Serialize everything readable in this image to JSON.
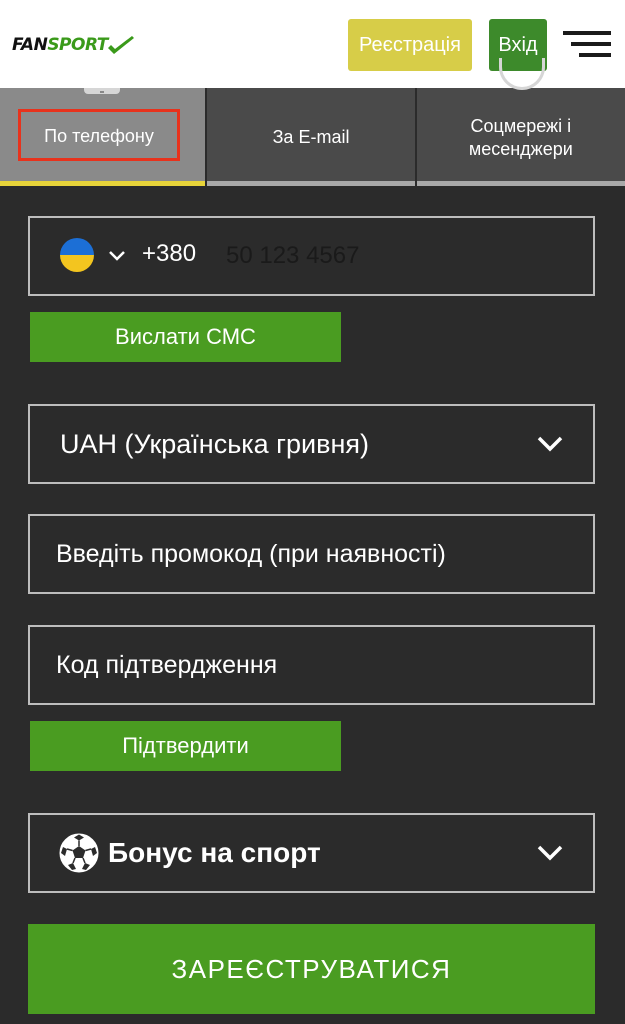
{
  "header": {
    "logo": {
      "part1": "FAN",
      "part2": "SPORT"
    },
    "register_label": "Реєстрація",
    "login_label": "Вхід",
    "menu_icon": "hamburger-menu-icon"
  },
  "tabs": [
    {
      "label": "По телефону",
      "active": true
    },
    {
      "label": "За E-mail",
      "active": false
    },
    {
      "label_line1": "Соцмережі і",
      "label_line2": "месенджери",
      "active": false
    }
  ],
  "form": {
    "phone": {
      "flag": "ukraine-flag-icon",
      "country_code": "+380",
      "placeholder": "50 123 4567"
    },
    "send_sms_label": "Вислати СМС",
    "currency": {
      "value": "UAH (Українська гривня)"
    },
    "promo": {
      "placeholder": "Введіть промокод (при наявності)"
    },
    "confirmation_code": {
      "placeholder": "Код підтвердження"
    },
    "confirm_label": "Підтвердити",
    "bonus": {
      "value": "Бонус на спорт",
      "icon": "soccer-ball-icon"
    },
    "register_label": "ЗАРЕЄСТРУВАТИСЯ"
  },
  "colors": {
    "background": "#2b2b2b",
    "accent_green": "#4a9c21",
    "register_yellow": "#d7cd48",
    "login_green": "#3d8a2b",
    "active_tab_underline": "#e8d43a",
    "highlight_red": "#e8321c"
  }
}
